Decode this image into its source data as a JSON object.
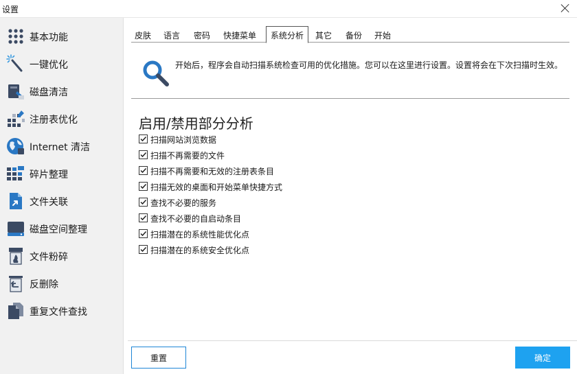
{
  "window": {
    "title": "设置"
  },
  "sidebar": {
    "items": [
      {
        "label": "基本功能",
        "icon": "grid-dots-icon"
      },
      {
        "label": "一键优化",
        "icon": "magic-wand-icon"
      },
      {
        "label": "磁盘清洁",
        "icon": "disk-clean-icon"
      },
      {
        "label": "注册表优化",
        "icon": "registry-icon"
      },
      {
        "label": "Internet 清洁",
        "icon": "globe-icon"
      },
      {
        "label": "碎片整理",
        "icon": "defrag-icon"
      },
      {
        "label": "文件关联",
        "icon": "file-association-icon"
      },
      {
        "label": "磁盘空间整理",
        "icon": "disk-space-icon"
      },
      {
        "label": "文件粉碎",
        "icon": "file-shredder-icon"
      },
      {
        "label": "反删除",
        "icon": "undelete-icon"
      },
      {
        "label": "重复文件查找",
        "icon": "duplicate-file-icon"
      }
    ]
  },
  "tabs": [
    {
      "label": "皮肤"
    },
    {
      "label": "语言"
    },
    {
      "label": "密码"
    },
    {
      "label": "快捷菜单"
    },
    {
      "label": "系统分析",
      "active": true
    },
    {
      "label": "其它"
    },
    {
      "label": "备份"
    },
    {
      "label": "开始"
    }
  ],
  "intro": {
    "text": "开始后，程序会自动扫描系统检查可用的优化措施。您可以在这里进行设置。设置将会在下次扫描时生效。"
  },
  "section": {
    "title": "启用/禁用部分分析",
    "options": [
      {
        "label": "扫描网站浏览数据",
        "checked": true
      },
      {
        "label": "扫描不再需要的文件",
        "checked": true
      },
      {
        "label": "扫描不再需要和无效的注册表条目",
        "checked": true
      },
      {
        "label": "扫描无效的桌面和开始菜单快捷方式",
        "checked": true
      },
      {
        "label": "查找不必要的服务",
        "checked": true
      },
      {
        "label": "查找不必要的自启动条目",
        "checked": true
      },
      {
        "label": "扫描潜在的系统性能优化点",
        "checked": true
      },
      {
        "label": "扫描潜在的系统安全优化点",
        "checked": true
      }
    ]
  },
  "footer": {
    "reset_label": "重置",
    "ok_label": "确定"
  },
  "colors": {
    "accent": "#1ea2f0",
    "sidebar_bg": "#f1f1f1",
    "icon_blue": "#2a78c4",
    "icon_dark": "#3b4a63"
  }
}
